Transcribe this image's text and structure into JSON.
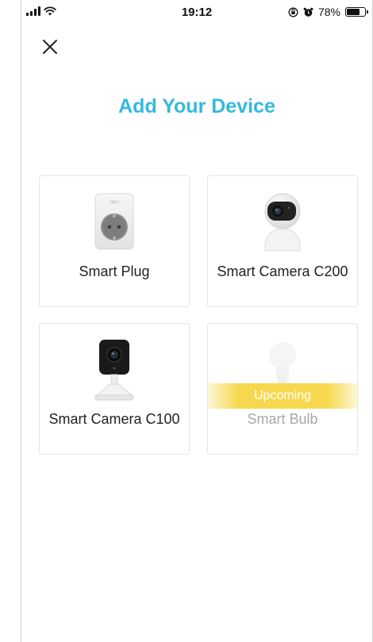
{
  "status_bar": {
    "time": "19:12",
    "battery": "78%",
    "battery_level": 0.78
  },
  "page": {
    "title": "Add Your Device"
  },
  "devices": [
    {
      "label": "Smart Plug",
      "icon": "smart-plug-icon",
      "plug_brand": "tapo"
    },
    {
      "label": "Smart Camera C200",
      "icon": "pan-tilt-camera-icon"
    },
    {
      "label": "Smart Camera C100",
      "icon": "home-camera-icon"
    },
    {
      "label": "Smart Bulb",
      "icon": "bulb-icon",
      "badge": "Upcoming"
    }
  ],
  "colors": {
    "accent": "#35b8e0",
    "upcoming_badge": "#f6d84f"
  }
}
